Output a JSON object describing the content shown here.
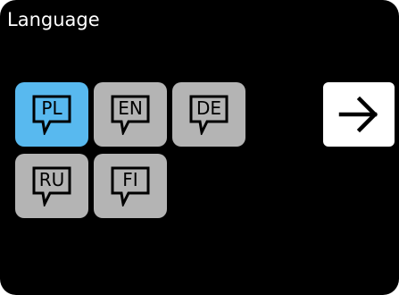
{
  "title": "Language",
  "languages": [
    {
      "code": "PL",
      "selected": true
    },
    {
      "code": "EN",
      "selected": false
    },
    {
      "code": "DE",
      "selected": false
    },
    {
      "code": "RU",
      "selected": false
    },
    {
      "code": "FI",
      "selected": false
    }
  ],
  "next_button": {
    "icon": "arrow-right-icon"
  },
  "colors": {
    "background": "#000000",
    "selected": "#58b9ef",
    "unselected": "#b4b4b4",
    "next_button": "#ffffff"
  }
}
